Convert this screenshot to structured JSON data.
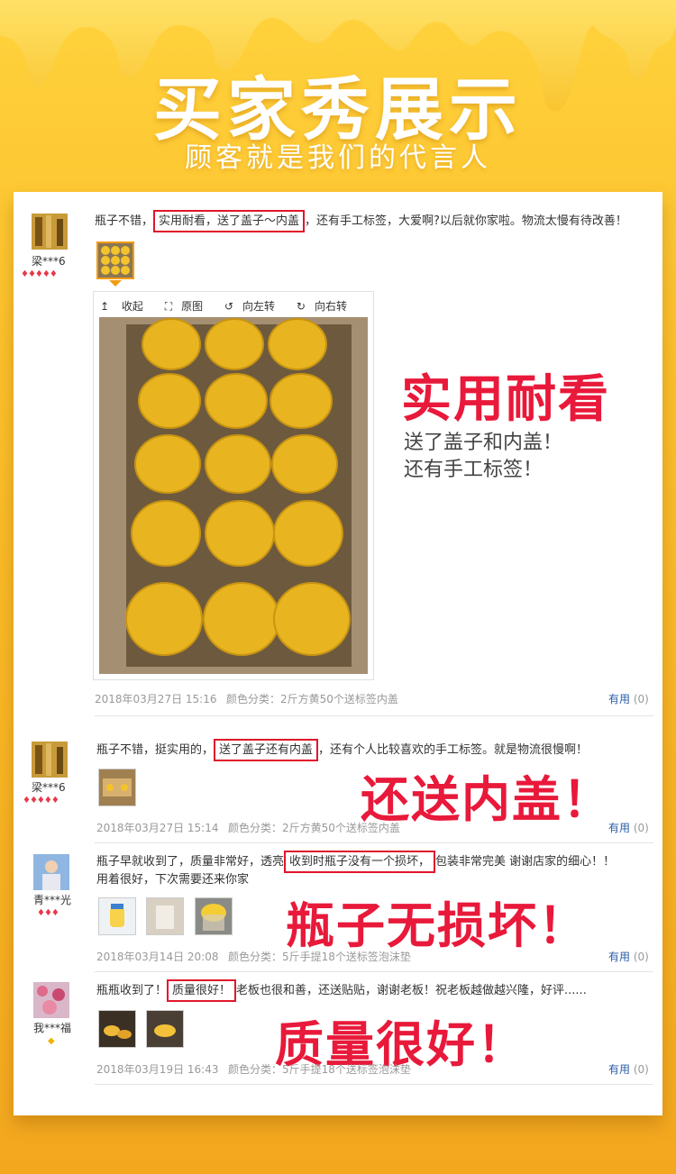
{
  "header": {
    "title": "买家秀展示",
    "subtitle": "顾客就是我们的代言人"
  },
  "colors": {
    "accent": "#e8193a",
    "link": "#2a5ca7",
    "honey": "#f7b526"
  },
  "reviews": [
    {
      "username": "梁***6",
      "text_before": "瓶子不错，",
      "text_highlight": "实用耐看，送了盖子～内盖",
      "text_after": "，还有手工标签，大爱啊?以后就你家啦。物流太慢有待改善！",
      "date": "2018年03月27日 15:16",
      "spec": "颜色分类：2斤方黄50个送标签内盖",
      "useful_label": "有用",
      "useful_count": "(0)",
      "toolbar": {
        "collapse": "收起",
        "original": "原图",
        "rotate_left": "向左转",
        "rotate_right": "向右转"
      },
      "callout_title": "实用耐看",
      "callout_line1": "送了盖子和内盖！",
      "callout_line2": "还有手工标签！"
    },
    {
      "username": "梁***6",
      "text_before": "瓶子不错，挺实用的，",
      "text_highlight": "送了盖子还有内盖",
      "text_after": "，还有个人比较喜欢的手工标签。就是物流很慢啊！",
      "date": "2018年03月27日 15:14",
      "spec": "颜色分类：2斤方黄50个送标签内盖",
      "useful_label": "有用",
      "useful_count": "(0)",
      "callout": "还送内盖！"
    },
    {
      "username": "青***光",
      "text_before": "瓶子早就收到了，质量非常好，透亮",
      "text_highlight": "收到时瓶子没有一个损坏，",
      "text_after": "包装非常完美 谢谢店家的细心！！",
      "text_line2": "用着很好，下次需要还来你家",
      "date": "2018年03月14日 20:08",
      "spec": "颜色分类：5斤手提18个送标签泡沫垫",
      "useful_label": "有用",
      "useful_count": "(0)",
      "callout": "瓶子无损坏！"
    },
    {
      "username": "我***福",
      "text_before": "瓶瓶收到了！",
      "text_highlight": "质量很好！",
      "text_after": "老板也很和善，还送贴贴，谢谢老板！祝老板越做越兴隆，好评......",
      "date": "2018年03月19日 16:43",
      "spec": "颜色分类：5斤手提18个送标签泡沫垫",
      "useful_label": "有用",
      "useful_count": "(0)",
      "callout": "质量很好！"
    }
  ]
}
